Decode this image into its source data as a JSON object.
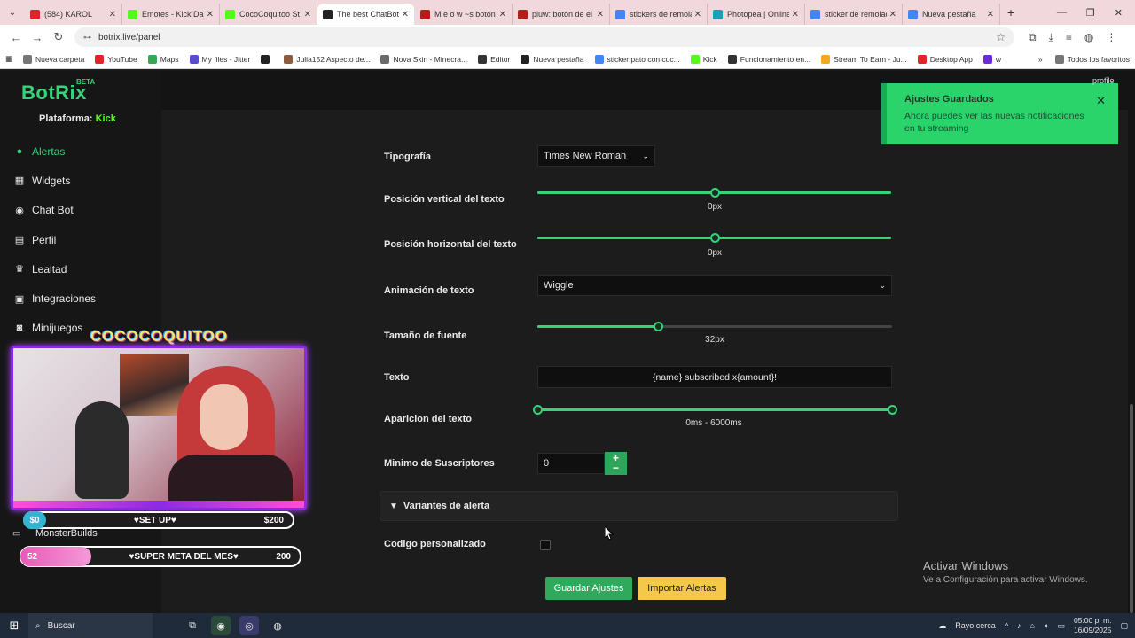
{
  "browser": {
    "tabs": [
      {
        "label": "(584) KAROL",
        "color": "#e0242a"
      },
      {
        "label": "Emotes - Kick Da",
        "color": "#53fc18"
      },
      {
        "label": "CocoCoquitoo St",
        "color": "#53fc18"
      },
      {
        "label": "The best ChatBot",
        "color": "#222222",
        "active": true
      },
      {
        "label": "M e o w ~s botón",
        "color": "#b71c1c"
      },
      {
        "label": "piuw: botón de el",
        "color": "#b71c1c"
      },
      {
        "label": "stickers de remola",
        "color": "#4285f4"
      },
      {
        "label": "Photopea | Online",
        "color": "#17a2b8"
      },
      {
        "label": "sticker de remolac",
        "color": "#4285f4"
      },
      {
        "label": "Nueva pestaña",
        "color": "#4285f4"
      }
    ],
    "url": "botrix.live/panel",
    "bookmarks": [
      {
        "label": "Nueva carpeta",
        "color": "#777777"
      },
      {
        "label": "YouTube",
        "color": "#e0242a"
      },
      {
        "label": "Maps",
        "color": "#34a853"
      },
      {
        "label": "My files - Jitter",
        "color": "#5a4bd1"
      },
      {
        "label": "",
        "color": "#222222"
      },
      {
        "label": "Julia152 Aspecto de...",
        "color": "#8d5a3b"
      },
      {
        "label": "Nova Skin - Minecra...",
        "color": "#6b6b6b"
      },
      {
        "label": "Editor",
        "color": "#333333"
      },
      {
        "label": "Nueva pestaña",
        "color": "#222222"
      },
      {
        "label": "sticker pato con cuc...",
        "color": "#4285f4"
      },
      {
        "label": "Kick",
        "color": "#53fc18"
      },
      {
        "label": "Funcionamiento en...",
        "color": "#333333"
      },
      {
        "label": "Stream To Earn - Ju...",
        "color": "#f5a623"
      },
      {
        "label": "Desktop App",
        "color": "#e0242a"
      },
      {
        "label": "w",
        "color": "#6c2bd9"
      }
    ],
    "bookmarks_all": "Todos los favoritos"
  },
  "sidebar": {
    "logo": "BotRix",
    "beta": "BETA",
    "platform_label": "Plataforma:",
    "platform_value": "Kick",
    "items": [
      {
        "label": "Alertas",
        "icon": "bell-icon",
        "glyph": "●",
        "active": true
      },
      {
        "label": "Widgets",
        "icon": "grid-icon",
        "glyph": "▦"
      },
      {
        "label": "Chat Bot",
        "icon": "robot-icon",
        "glyph": "◉"
      },
      {
        "label": "Perfil",
        "icon": "id-card-icon",
        "glyph": "▤"
      },
      {
        "label": "Lealtad",
        "icon": "trophy-icon",
        "glyph": "♛"
      },
      {
        "label": "Integraciones",
        "icon": "plug-icon",
        "glyph": "▣"
      },
      {
        "label": "Minijuegos",
        "icon": "gamepad-icon",
        "glyph": "◙"
      }
    ],
    "monster_label": "MonsterBuilds"
  },
  "overlay": {
    "title": "COCOCOQUITOO",
    "goal1": {
      "left": "$0",
      "middle": "♥SET UP♥",
      "right": "$200"
    },
    "goal2": {
      "left": "52",
      "middle": "♥SUPER META DEL MES♥",
      "right": "200"
    }
  },
  "form": {
    "typography_label": "Tipografía",
    "typography_value": "Times New Roman",
    "vpos_label": "Posición vertical del texto",
    "vpos_value": "0px",
    "hpos_label": "Posición horizontal del texto",
    "hpos_value": "0px",
    "anim_label": "Animación de texto",
    "anim_value": "Wiggle",
    "font_size_label": "Tamaño de fuente",
    "font_size_value": "32px",
    "text_label": "Texto",
    "text_value": "{name} subscribed x{amount}!",
    "appear_label": "Aparicion del texto",
    "appear_value": "0ms - 6000ms",
    "min_subs_label": "Minimo de Suscriptores",
    "min_subs_value": "0",
    "variants_label": "Variantes de alerta",
    "custom_code_label": "Codigo personalizado",
    "save_button": "Guardar Ajustes",
    "import_button": "Importar Alertas"
  },
  "toast": {
    "title": "Ajustes Guardados",
    "body": "Ahora puedes ver las nuevas notificaciones en tu streaming"
  },
  "profile_tag": "profile",
  "windows_watermark": {
    "line1": "Activar Windows",
    "line2": "Ve a Configuración para activar Windows."
  },
  "taskbar": {
    "search": "Buscar",
    "weather": "Rayo cerca",
    "time": "05:00 p. m.",
    "date": "16/09/2025"
  },
  "colors": {
    "accent": "#35d37a",
    "toast": "#2bd46b",
    "import": "#f5c84a"
  }
}
